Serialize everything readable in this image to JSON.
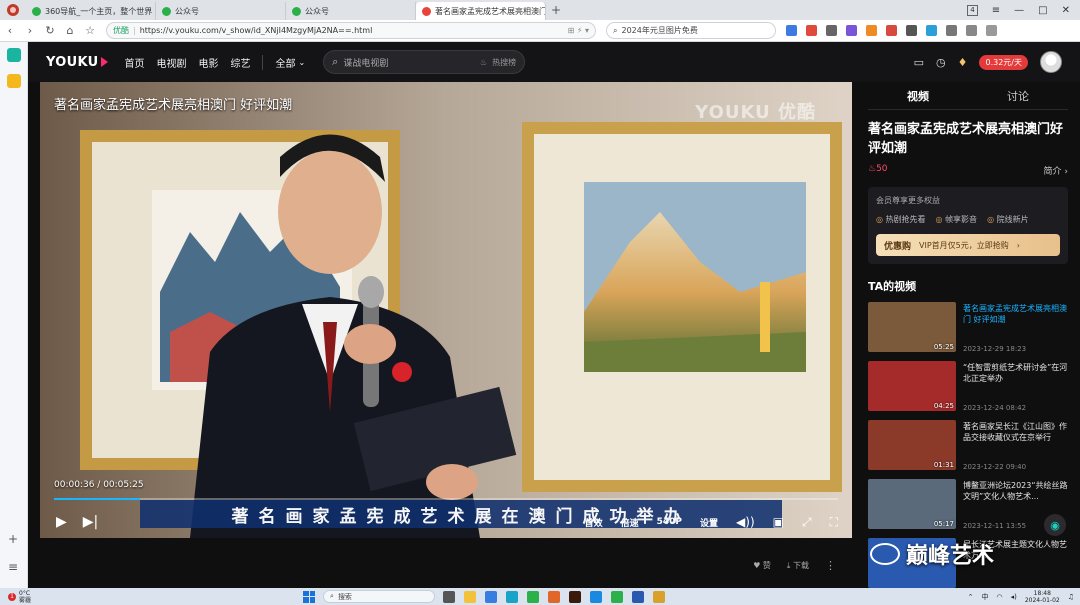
{
  "browser": {
    "tabs": [
      {
        "label": "360导航_一个主页，整个世界",
        "color": "#2bb04a",
        "active": false
      },
      {
        "label": "公众号",
        "color": "#2bb04a",
        "active": false
      },
      {
        "label": "公众号",
        "color": "#2bb04a",
        "active": false
      },
      {
        "label": "著名画家孟宪成艺术展亮相澳门",
        "color": "#e8443a",
        "active": true
      }
    ],
    "tab_count": "4",
    "url_safe": "优酷",
    "url": "https://v.youku.com/v_show/id_XNjI4MzgyMjA2NA==.html",
    "search_value": "2024年元旦图片免费"
  },
  "site": {
    "logo": "YOUKU",
    "nav": [
      "首页",
      "电视剧",
      "电影",
      "综艺"
    ],
    "nav_all": "全部",
    "search_placeholder": "谍战电视剧",
    "hot_search": "热搜榜",
    "vip_price": "0.32元/天"
  },
  "player": {
    "title": "著名画家孟宪成艺术展亮相澳门 好评如潮",
    "watermark": "YOUKU 优酷",
    "subtitle": "著名画家孟宪成艺术展在澳门成功举办",
    "current_time": "00:00:36",
    "duration": "00:05:25",
    "progress": 0.11,
    "controls": {
      "quality_first": "首效",
      "speed": "倍速",
      "resolution": "540P",
      "settings": "设置"
    }
  },
  "below": {
    "like": "赞",
    "download": "下载"
  },
  "panel": {
    "tabs": [
      "视频",
      "讨论"
    ],
    "title": "著名画家孟宪成艺术展亮相澳门好评如潮",
    "heat": "50",
    "intro": "简介",
    "vip": {
      "head": "会员尊享更多权益",
      "perks": [
        "热剧抢先看",
        "帧享影音",
        "院线新片"
      ],
      "buy_label": "优惠购",
      "buy_text": "VIP首月仅5元，立即抢购"
    },
    "ta_heading": "TA的视频",
    "videos": [
      {
        "title": "著名画家孟宪成艺术展亮相澳门 好评如潮",
        "duration": "05:25",
        "date": "2023-12-29 18:23",
        "current": true,
        "thumb": "#7a5a3a"
      },
      {
        "title": "“任智雷剪纸艺术研讨会”在河北正定举办",
        "duration": "04:25",
        "date": "2023-12-24 08:42",
        "current": false,
        "thumb": "#a52a2a"
      },
      {
        "title": "著名画家吴长江《江山图》作品交接收藏仪式在京举行",
        "duration": "01:31",
        "date": "2023-12-22 09:40",
        "current": false,
        "thumb": "#8b3a2a"
      },
      {
        "title": "博鳌亚洲论坛2023“共绘丝路文明”文化人物艺术...",
        "duration": "05:17",
        "date": "2023-12-11 13:55",
        "current": false,
        "thumb": "#5a6a7a"
      },
      {
        "title": "吴长江艺术展主题文化人物艺术万...",
        "duration": "",
        "date": "",
        "current": false,
        "thumb": "#2a5ab0"
      }
    ]
  },
  "overlay_mark": "巅峰艺术",
  "taskbar": {
    "temp": "0°C",
    "weather": "雾霾",
    "notif": "1",
    "search": "搜索",
    "time": "18:48",
    "date": "2024-01-02"
  }
}
